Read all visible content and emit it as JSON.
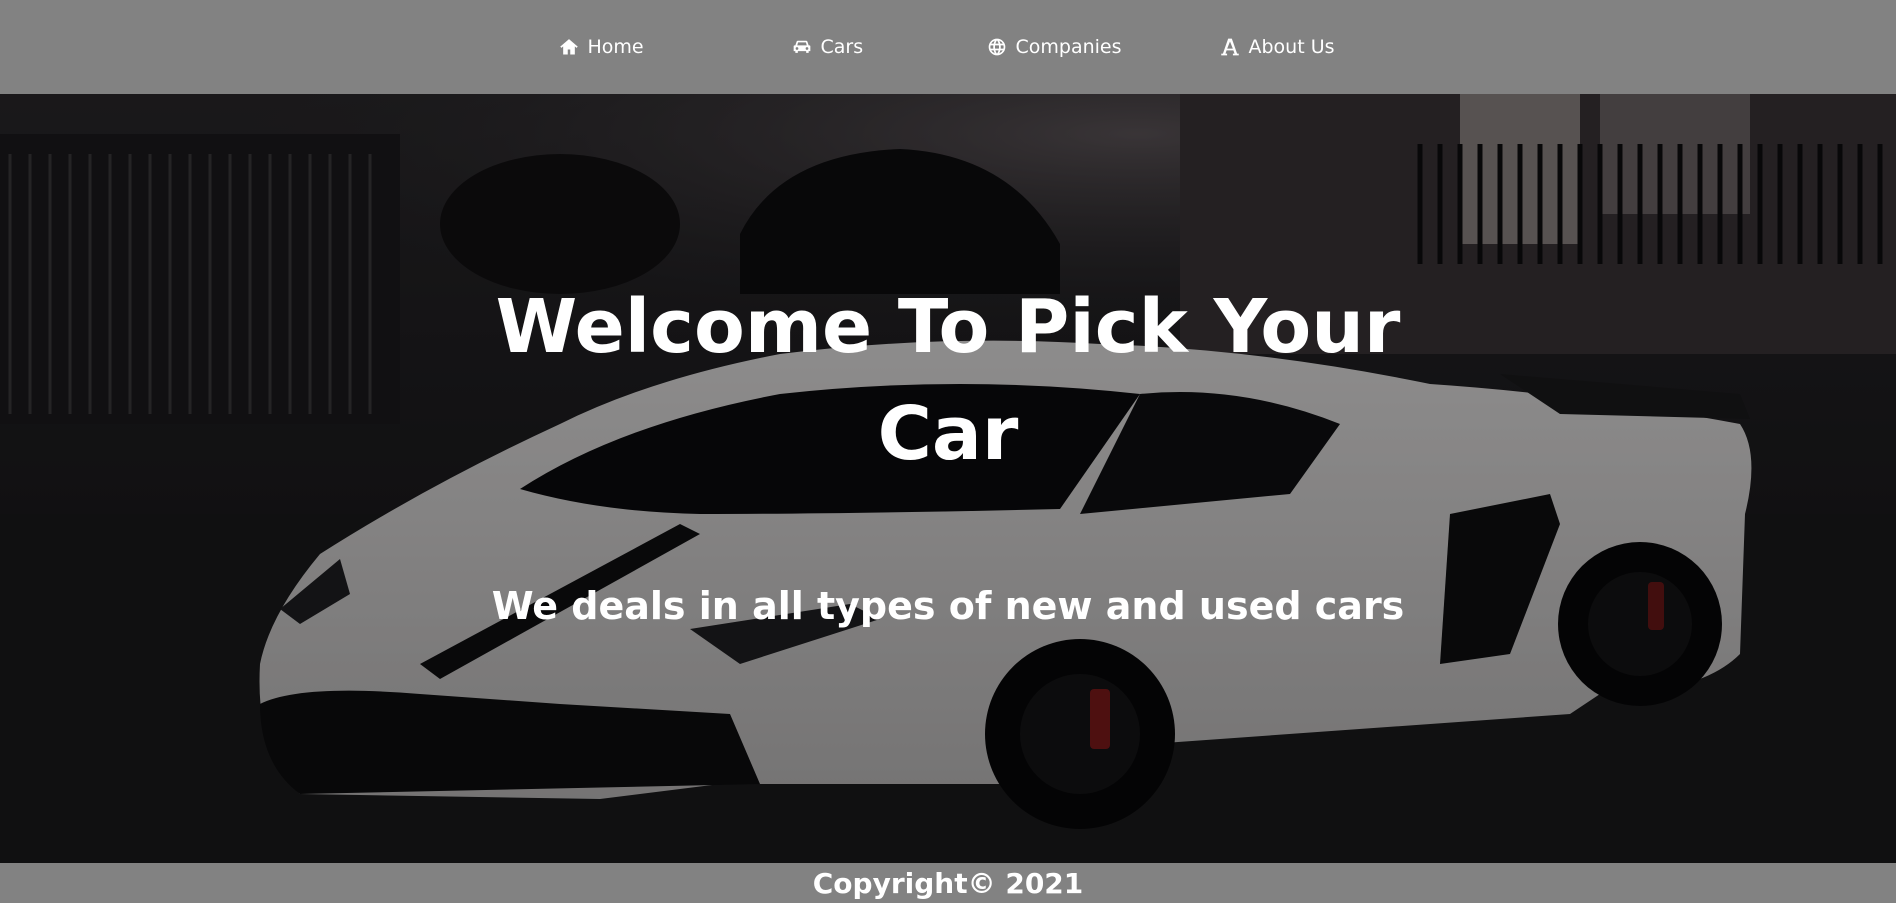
{
  "nav": {
    "items": [
      {
        "label": "Home",
        "icon": "home-icon"
      },
      {
        "label": "Cars",
        "icon": "car-icon"
      },
      {
        "label": "Companies",
        "icon": "globe-icon"
      },
      {
        "label": "About Us",
        "icon": "font-a-icon"
      }
    ]
  },
  "hero": {
    "title_line1": "Welcome To Pick Your",
    "title_line2": "Car",
    "subtitle": "We deals in all types of new and used cars"
  },
  "footer": {
    "copyright": "Copyright© 2021"
  },
  "colors": {
    "bar_gray": "#828282",
    "text": "#ffffff",
    "car_body": "#d8d6d6"
  }
}
